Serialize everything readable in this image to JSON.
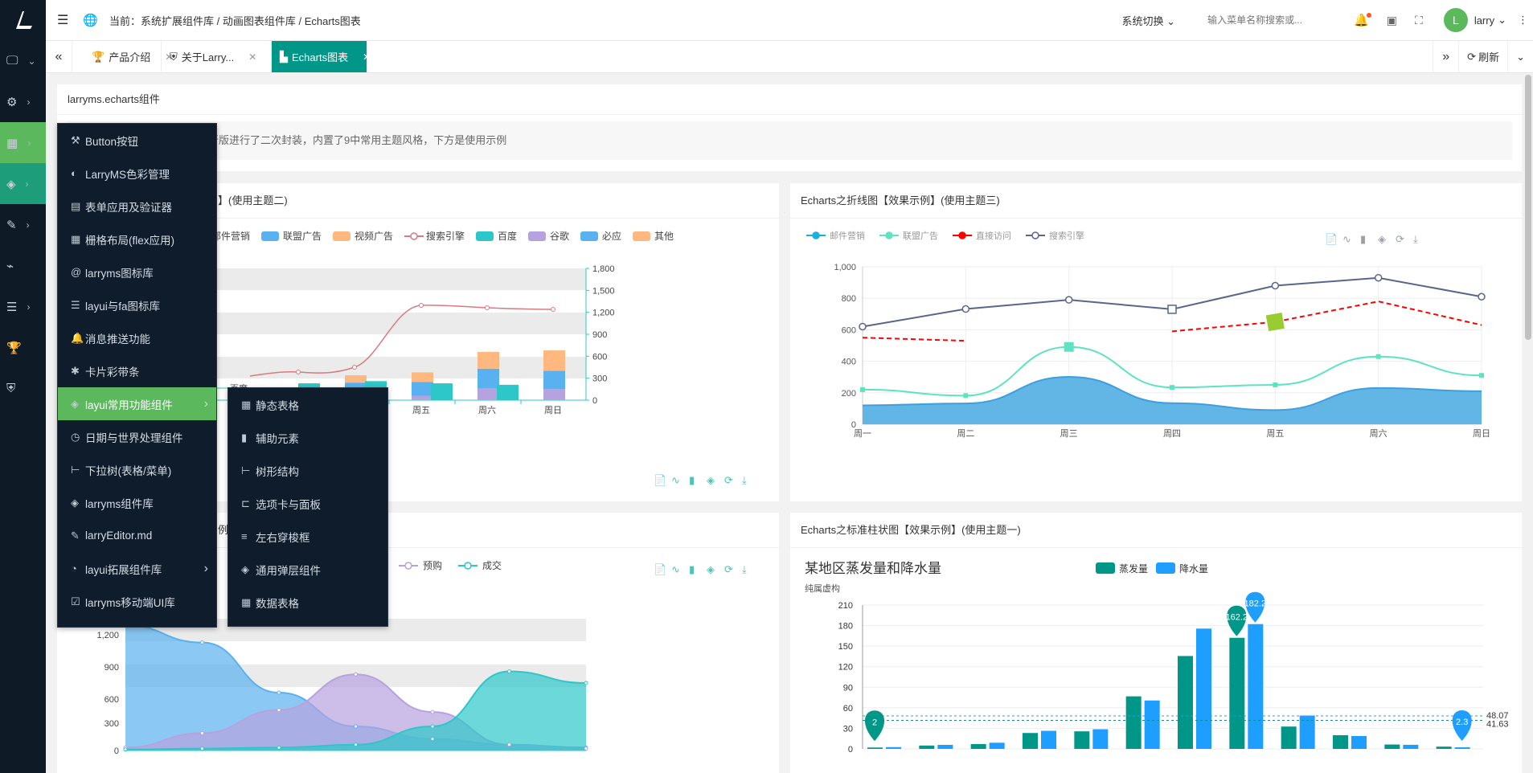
{
  "topbar": {
    "breadcrumb": "当前：系统扩展组件库 / 动画图表组件库 / Echarts图表",
    "system_switch": "系统切换",
    "search_placeholder": "输入菜单名称搜索或...",
    "user_name": "larry"
  },
  "tabs": [
    {
      "label": "产品介绍",
      "icon": "trophy-icon"
    },
    {
      "label": "关于Larry...",
      "icon": "shield-icon"
    },
    {
      "label": "Echarts图表",
      "icon": "chart-icon"
    }
  ],
  "tab_actions": {
    "refresh": "刷新"
  },
  "intro": {
    "title": "larryms.echarts组件",
    "desc": "该组件基于开源ECharts库最新版进行了二次封装，内置了9中常用主题风格，下方是使用示例"
  },
  "sidebar_menu": [
    {
      "label": "Button按钮",
      "icon": "hammer-icon"
    },
    {
      "label": "LarryMS色彩管理",
      "icon": "palette-icon"
    },
    {
      "label": "表单应用及验证器",
      "icon": "form-icon"
    },
    {
      "label": "栅格布局(flex应用)",
      "icon": "grid-icon"
    },
    {
      "label": "larryms图标库",
      "icon": "at-icon"
    },
    {
      "label": "layui与fa图标库",
      "icon": "stack-icon"
    },
    {
      "label": "消息推送功能",
      "icon": "bell-icon"
    },
    {
      "label": "卡片彩带条",
      "icon": "ribbon-icon"
    },
    {
      "label": "layui常用功能组件",
      "icon": "layers-icon"
    },
    {
      "label": "日期与世界处理组件",
      "icon": "clock-icon"
    },
    {
      "label": "下拉树(表格/菜单)",
      "icon": "tree-icon"
    },
    {
      "label": "larryms组件库",
      "icon": "layers-icon"
    },
    {
      "label": "larryEditor.md",
      "icon": "edit-icon"
    },
    {
      "label": "layui拓展组件库",
      "icon": "pie-icon"
    },
    {
      "label": "larryms移动端UI库",
      "icon": "check-icon"
    }
  ],
  "submenu": [
    {
      "label": "静态表格",
      "icon": "table-icon"
    },
    {
      "label": "辅助元素",
      "icon": "bars-icon"
    },
    {
      "label": "树形结构",
      "icon": "tree-icon"
    },
    {
      "label": "选项卡与面板",
      "icon": "tabs-icon"
    },
    {
      "label": "左右穿梭框",
      "icon": "list-icon"
    },
    {
      "label": "通用弹层组件",
      "icon": "layers-icon"
    },
    {
      "label": "数据表格",
      "icon": "table-icon"
    }
  ],
  "cards": {
    "c1_title": "】(使用主题二)",
    "c2_title": "Echarts之折线图【效果示例】(使用主题三)",
    "c3_title": "例",
    "c4_title": "Echarts之标准柱状图【效果示例】(使用主题一)"
  },
  "colors": {
    "accent": "#009688",
    "sidebar": "#0f1a27",
    "menu_active": "#5cb85c"
  },
  "chart_data": [
    {
      "type": "bar",
      "categories": [
        "周四",
        "周五",
        "周六",
        "周日"
      ],
      "legend": [
        "邮件营销",
        "联盟广告",
        "视频广告",
        "搜索引擎",
        "百度",
        "谷歌",
        "必应",
        "其他"
      ],
      "series": [
        {
          "name": "百度",
          "values": [
            230,
            260,
            230,
            210
          ]
        },
        {
          "name": "谷歌",
          "values": [
            90,
            60,
            160,
            150
          ]
        },
        {
          "name": "必应",
          "values": [
            150,
            190,
            270,
            250
          ]
        },
        {
          "name": "其他",
          "values": [
            100,
            130,
            230,
            280
          ]
        },
        {
          "name": "搜索引擎",
          "values": [
            1000,
            1670,
            1590,
            1560
          ]
        }
      ],
      "pie_label": "百度",
      "y_right_ticks": [
        "1,800",
        "1,500",
        "1,200",
        "900",
        "600",
        "300",
        "0"
      ]
    },
    {
      "type": "line",
      "title": "",
      "categories": [
        "周一",
        "周二",
        "周三",
        "周四",
        "周五",
        "周六",
        "周日"
      ],
      "legend": [
        "邮件营销",
        "联盟广告",
        "直接访问",
        "搜索引擎"
      ],
      "ylim": [
        0,
        1000
      ],
      "yticks": [
        "1,000",
        "800",
        "600",
        "400",
        "200",
        "0"
      ],
      "series": [
        {
          "name": "邮件营销",
          "values": [
            120,
            132,
            301,
            134,
            90,
            230,
            210
          ]
        },
        {
          "name": "联盟广告",
          "values": [
            220,
            182,
            491,
            234,
            250,
            430,
            310
          ]
        },
        {
          "name": "直接访问",
          "values": [
            550,
            530,
            null,
            590,
            650,
            780,
            630
          ]
        },
        {
          "name": "搜索引擎",
          "values": [
            620,
            732,
            790,
            730,
            880,
            930,
            810
          ]
        }
      ]
    },
    {
      "type": "area",
      "legend": [
        "预购",
        "成交"
      ],
      "yticks": [
        "1,200",
        "900",
        "600",
        "300",
        "0"
      ],
      "series": [
        {
          "name": "series-blue",
          "values": [
            1300,
            1120,
            600,
            250,
            120,
            60,
            30
          ]
        },
        {
          "name": "预购",
          "values": [
            30,
            180,
            420,
            790,
            400,
            60,
            20
          ]
        },
        {
          "name": "成交",
          "values": [
            10,
            20,
            30,
            60,
            250,
            820,
            700
          ]
        }
      ]
    },
    {
      "type": "bar",
      "title": "某地区蒸发量和降水量",
      "subtitle": "纯属虚构",
      "legend": [
        "蒸发量",
        "降水量"
      ],
      "ylim": [
        0,
        210
      ],
      "yticks": [
        "210",
        "180",
        "150",
        "120",
        "90",
        "60",
        "30",
        "0"
      ],
      "series": [
        {
          "name": "蒸发量",
          "values": [
            2.0,
            4.9,
            7.0,
            23.2,
            25.6,
            76.7,
            135.6,
            162.2,
            32.6,
            20.0,
            6.4,
            3.3
          ]
        },
        {
          "name": "降水量",
          "values": [
            2.6,
            5.9,
            9.0,
            26.4,
            28.7,
            70.7,
            175.6,
            182.2,
            48.7,
            18.8,
            6.0,
            2.3
          ]
        }
      ],
      "mark_labels": [
        "162.2",
        "182.2",
        "2",
        "2.3"
      ],
      "avg_labels": [
        "48.07",
        "41.63"
      ]
    }
  ]
}
